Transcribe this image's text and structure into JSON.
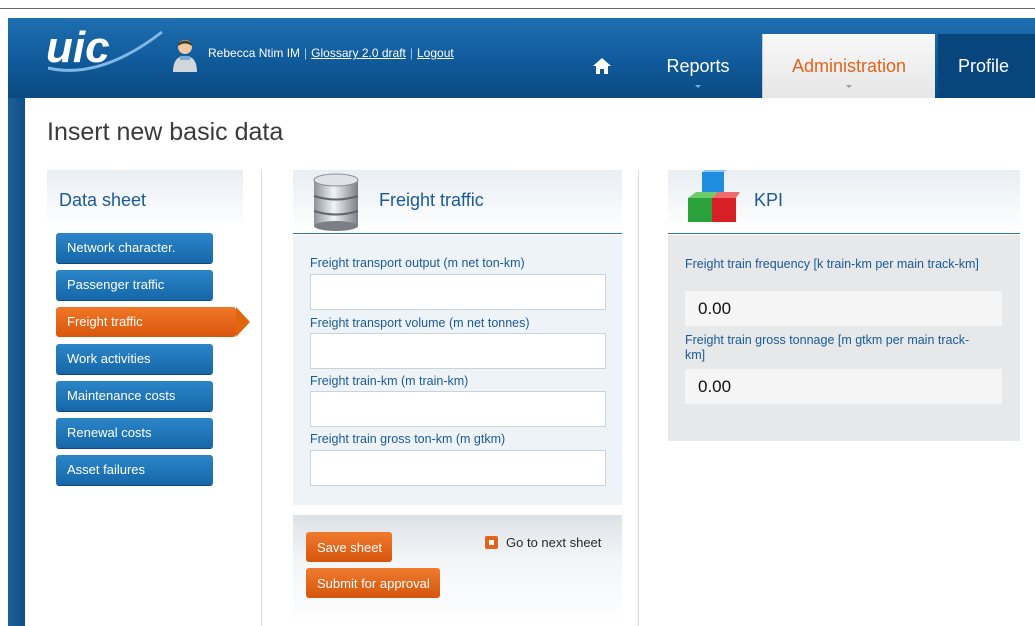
{
  "header": {
    "logo_text": "uic",
    "user_name": "Rebecca Ntim IM",
    "glossary_link": "Glossary 2.0 draft",
    "logout_link": "Logout",
    "tabs": [
      {
        "label": "Reports"
      },
      {
        "label": "Administration"
      },
      {
        "label": "Profile"
      }
    ]
  },
  "page": {
    "title": "Insert new basic data"
  },
  "sidebar": {
    "heading": "Data sheet",
    "items": [
      {
        "label": "Network character."
      },
      {
        "label": "Passenger traffic"
      },
      {
        "label": "Freight traffic"
      },
      {
        "label": "Work activities"
      },
      {
        "label": "Maintenance costs"
      },
      {
        "label": "Renewal costs"
      },
      {
        "label": "Asset failures"
      }
    ],
    "active_index": 2
  },
  "form": {
    "heading": "Freight traffic",
    "fields": [
      {
        "label": "Freight transport output (m net ton-km)",
        "value": ""
      },
      {
        "label": "Freight transport volume (m net tonnes)",
        "value": ""
      },
      {
        "label": "Freight train-km (m train-km)",
        "value": ""
      },
      {
        "label": "Freight train gross ton-km (m gtkm)",
        "value": ""
      }
    ],
    "save_button": "Save sheet",
    "submit_button": "Submit for approval",
    "next_link": "Go to next sheet"
  },
  "kpi": {
    "heading": "KPI",
    "items": [
      {
        "label": "Freight train frequency [k train-km per main track-km]",
        "value": "0.00"
      },
      {
        "label": "Freight train gross tonnage [m gtkm per main track-km]",
        "value": "0.00"
      }
    ]
  },
  "colors": {
    "brand_blue": "#0f5a9a",
    "accent_orange": "#e0641c",
    "label_blue": "#1a5a98"
  }
}
